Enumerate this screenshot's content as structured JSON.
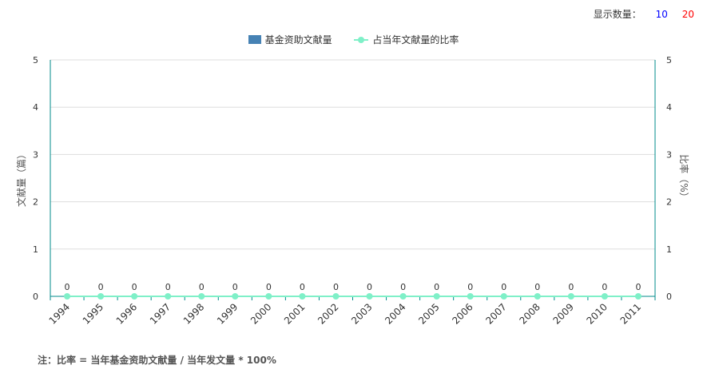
{
  "display_count": {
    "label": "显示数量：",
    "options": [
      {
        "value": "10",
        "color": "#0000ff"
      },
      {
        "value": "20",
        "color": "#ff0000"
      }
    ]
  },
  "note": "注：比率 = 当年基金资助文献量 / 当年发文量 * 100%",
  "colors": {
    "bar": "#4682b4",
    "line": "#7ff0c8",
    "axis": "#008b8b",
    "grid": "#dddddd"
  },
  "chart_data": {
    "type": "bar",
    "categories": [
      "1994",
      "1995",
      "1996",
      "1997",
      "1998",
      "1999",
      "2000",
      "2001",
      "2002",
      "2003",
      "2004",
      "2005",
      "2006",
      "2007",
      "2008",
      "2009",
      "2010",
      "2011"
    ],
    "series": [
      {
        "name": "基金资助文献量",
        "type": "bar",
        "axis": "left",
        "values": [
          0,
          0,
          0,
          0,
          0,
          0,
          0,
          0,
          0,
          0,
          0,
          0,
          0,
          0,
          0,
          0,
          0,
          0
        ]
      },
      {
        "name": "占当年文献量的比率",
        "type": "line",
        "axis": "right",
        "values": [
          0,
          0,
          0,
          0,
          0,
          0,
          0,
          0,
          0,
          0,
          0,
          0,
          0,
          0,
          0,
          0,
          0,
          0
        ]
      }
    ],
    "ylabel": "文献量（篇）",
    "ylabel_right": "比率（%）",
    "ylim": [
      0,
      5
    ],
    "ylim_right": [
      0,
      5
    ],
    "yticks": [
      "0",
      "1",
      "2",
      "3",
      "4",
      "5"
    ],
    "legend_position": "top-center",
    "grid": true
  }
}
